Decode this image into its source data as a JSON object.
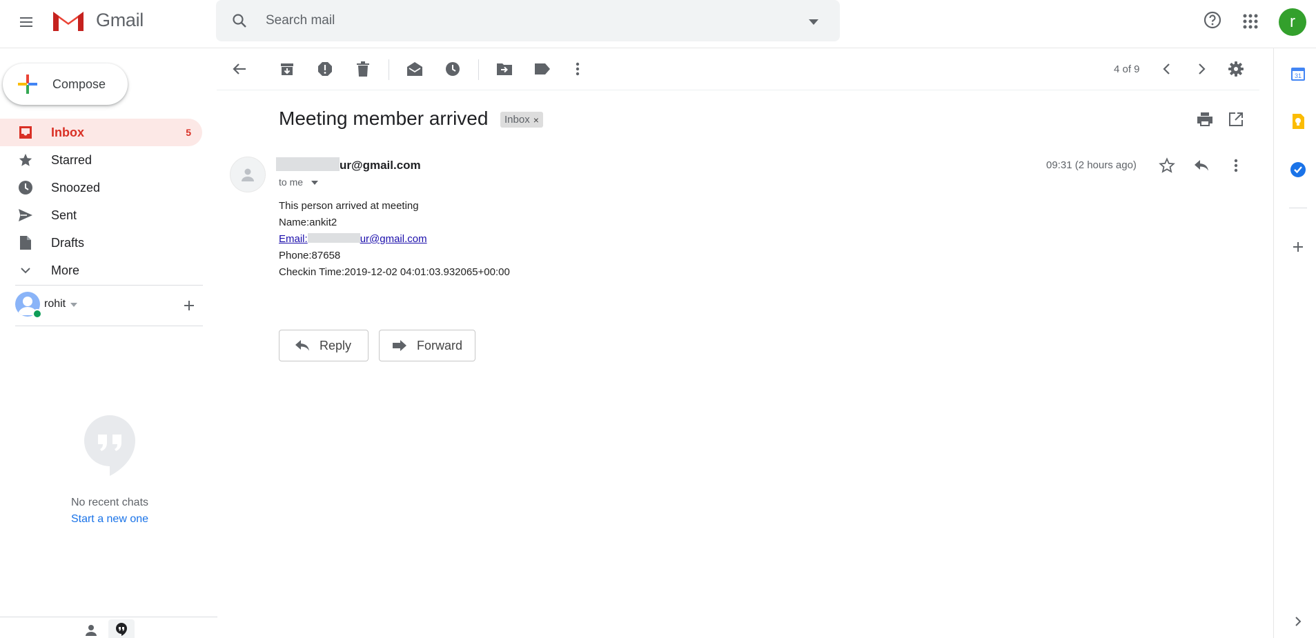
{
  "header": {
    "brand": "Gmail",
    "search_placeholder": "Search mail",
    "account_initial": "r"
  },
  "sidebar": {
    "compose_label": "Compose",
    "items": [
      {
        "label": "Inbox",
        "count": "5"
      },
      {
        "label": "Starred"
      },
      {
        "label": "Snoozed"
      },
      {
        "label": "Sent"
      },
      {
        "label": "Drafts"
      },
      {
        "label": "More"
      }
    ],
    "hangouts_user": "rohit",
    "no_chats": "No recent chats",
    "start_chat": "Start a new one"
  },
  "toolbar": {
    "pager": "4 of 9"
  },
  "email": {
    "subject": "Meeting member arrived",
    "label_chip": "Inbox",
    "sender_visible": "ur@gmail.com",
    "to": "to me",
    "time": "09:31 (2 hours ago)",
    "body": {
      "line1": "This person arrived at meeting",
      "line2": "Name:ankit2",
      "email_prefix": "Email:",
      "email_suffix": "ur@gmail.com",
      "line4": "Phone:87658",
      "line5": "Checkin Time:2019-12-02 04:01:03.932065+00:00"
    },
    "reply_label": "Reply",
    "forward_label": "Forward"
  },
  "colors": {
    "accent_red": "#d93025",
    "link_blue": "#1a0dab",
    "avatar_green": "#33a02c"
  }
}
